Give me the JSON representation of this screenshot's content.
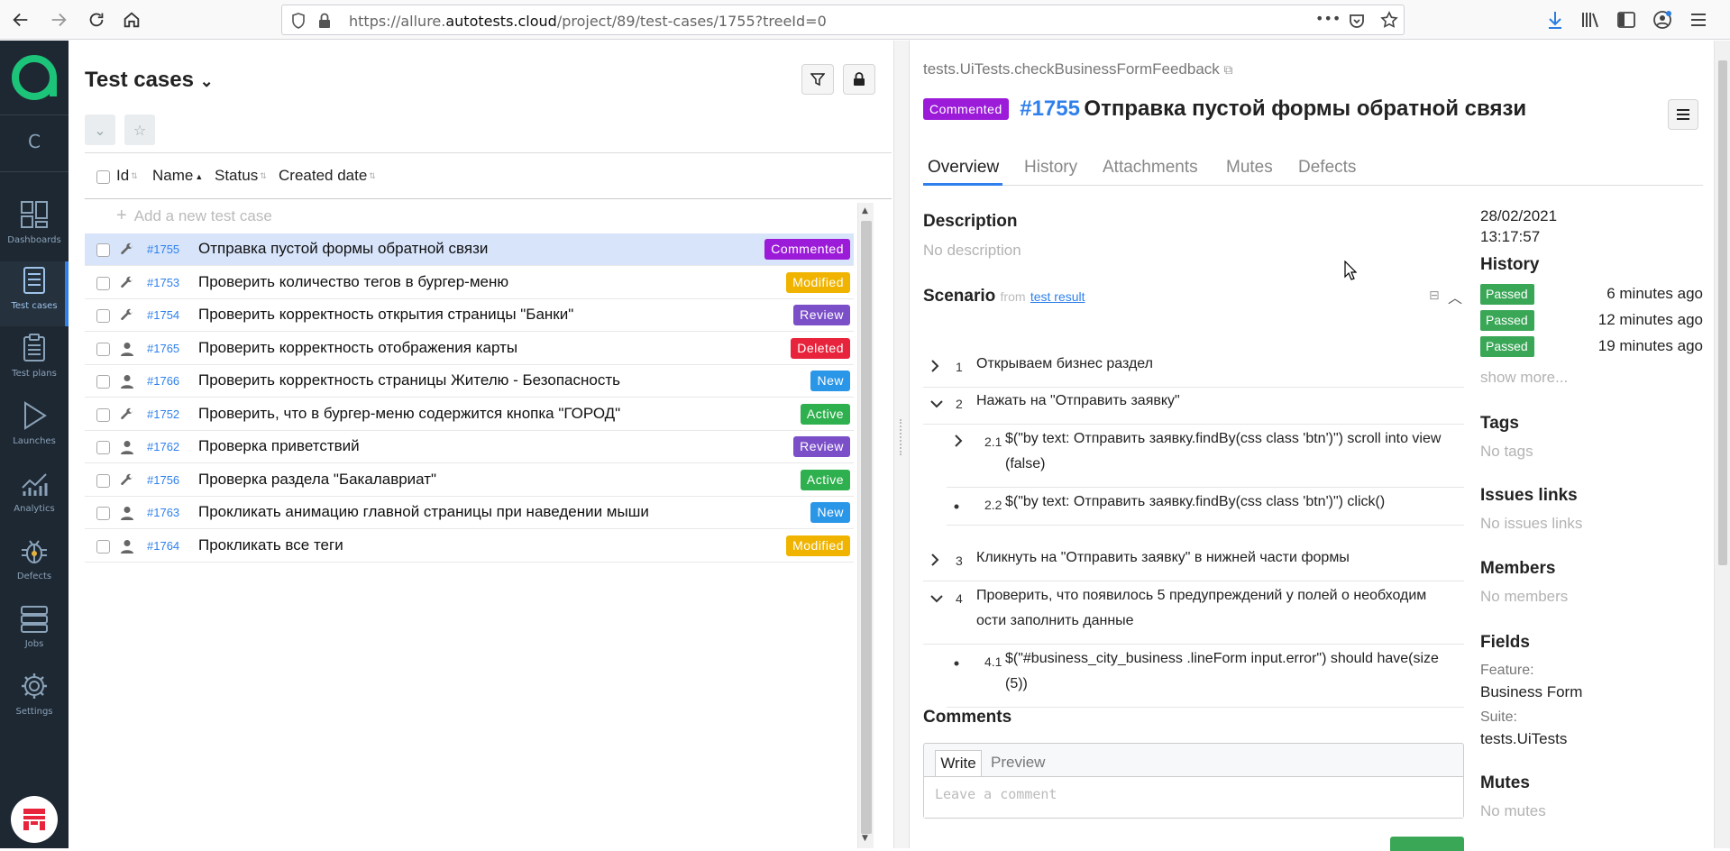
{
  "browser": {
    "url_prefix": "https://allure.",
    "url_host": "autotests.cloud",
    "url_path": "/project/89/test-cases/1755?treeId=0",
    "overflow": "•••"
  },
  "sidebar": {
    "logo_letter": "a",
    "collapse_letter": "C",
    "items": [
      {
        "label": "Dashboards",
        "icon": "dashboards-icon"
      },
      {
        "label": "Test cases",
        "icon": "test-cases-icon"
      },
      {
        "label": "Test plans",
        "icon": "test-plans-icon"
      },
      {
        "label": "Launches",
        "icon": "launches-icon"
      },
      {
        "label": "Analytics",
        "icon": "analytics-icon"
      },
      {
        "label": "Defects",
        "icon": "defects-icon"
      },
      {
        "label": "Jobs",
        "icon": "jobs-icon"
      },
      {
        "label": "Settings",
        "icon": "settings-icon"
      }
    ]
  },
  "test_cases": {
    "title": "Test cases",
    "columns": [
      "Id",
      "Name",
      "Status",
      "Created date"
    ],
    "add_placeholder": "Add a new test case",
    "rows": [
      {
        "id": "#1755",
        "name": "Отправка пустой формы обратной связи",
        "status": "Commented",
        "color": "#9b1bd9",
        "kind": "wrench",
        "selected": true
      },
      {
        "id": "#1753",
        "name": "Проверить количество тегов в бургер-меню",
        "status": "Modified",
        "color": "#f0b400",
        "kind": "wrench"
      },
      {
        "id": "#1754",
        "name": "Проверить корректность открытия страницы \"Банки\"",
        "status": "Review",
        "color": "#7b4fc8",
        "kind": "wrench"
      },
      {
        "id": "#1765",
        "name": "Проверить корректность отображения карты",
        "status": "Deleted",
        "color": "#e8243c",
        "kind": "person"
      },
      {
        "id": "#1766",
        "name": "Проверить корректность страницы Жителю - Безопасность",
        "status": "New",
        "color": "#2a96e8",
        "kind": "person"
      },
      {
        "id": "#1752",
        "name": "Проверить, что в бургер-меню содержится кнопка \"ГОРОД\"",
        "status": "Active",
        "color": "#2fb04e",
        "kind": "wrench"
      },
      {
        "id": "#1762",
        "name": "Проверка приветствий",
        "status": "Review",
        "color": "#7b4fc8",
        "kind": "person"
      },
      {
        "id": "#1756",
        "name": "Проверка раздела \"Бакалавриат\"",
        "status": "Active",
        "color": "#2fb04e",
        "kind": "wrench"
      },
      {
        "id": "#1763",
        "name": "Прокликать анимацию главной страницы при наведении мыши",
        "status": "New",
        "color": "#2a96e8",
        "kind": "person"
      },
      {
        "id": "#1764",
        "name": "Прокликать все теги",
        "status": "Modified",
        "color": "#f0b400",
        "kind": "person"
      }
    ]
  },
  "detail": {
    "path": "tests.UiTests.checkBusinessFormFeedback",
    "status_badge": "Commented",
    "id": "#1755",
    "title": "Отправка пустой формы обратной связи",
    "tabs": [
      "Overview",
      "History",
      "Attachments",
      "Mutes",
      "Defects"
    ],
    "description_heading": "Description",
    "description_empty": "No description",
    "scenario_heading": "Scenario",
    "scenario_from": "from",
    "scenario_link": "test result",
    "steps": [
      {
        "num": "1",
        "text": "Открываем бизнес раздел",
        "chev": "›"
      },
      {
        "num": "2",
        "text": "Нажать на \"Отправить заявку\"",
        "chev": "⌄"
      },
      {
        "num": "2.1",
        "text": "$(\"by text: Отправить заявку.findBy(css class 'btn')\") scroll into view (false)",
        "chev": "›"
      },
      {
        "num": "2.2",
        "text": "$(\"by text: Отправить заявку.findBy(css class 'btn')\") click()",
        "chev": "•"
      },
      {
        "num": "3",
        "text": "Кликнуть на \"Отправить заявку\" в нижней части формы",
        "chev": "›"
      },
      {
        "num": "4",
        "text": "Проверить, что появилось 5 предупреждений у полей о необходим ости заполнить данные",
        "chev": "⌄"
      },
      {
        "num": "4.1",
        "text": "$(\"#business_city_business .lineForm input.error\") should have(size (5))",
        "chev": "•"
      }
    ],
    "comments_heading": "Comments",
    "comment_tabs": [
      "Write",
      "Preview"
    ],
    "comment_placeholder": "Leave a comment",
    "date": "28/02/2021",
    "time": "13:17:57",
    "history_heading": "History",
    "history": [
      {
        "status": "Passed",
        "ago": "6 minutes ago"
      },
      {
        "status": "Passed",
        "ago": "12 minutes ago"
      },
      {
        "status": "Passed",
        "ago": "19 minutes ago"
      }
    ],
    "show_more": "show more...",
    "tags_heading": "Tags",
    "tags_empty": "No tags",
    "issues_heading": "Issues links",
    "issues_empty": "No issues links",
    "members_heading": "Members",
    "members_empty": "No members",
    "fields_heading": "Fields",
    "feature_label": "Feature:",
    "feature_value": "Business Form",
    "suite_label": "Suite:",
    "suite_value": "tests.UiTests",
    "mutes_heading": "Mutes",
    "mutes_empty": "No mutes"
  }
}
